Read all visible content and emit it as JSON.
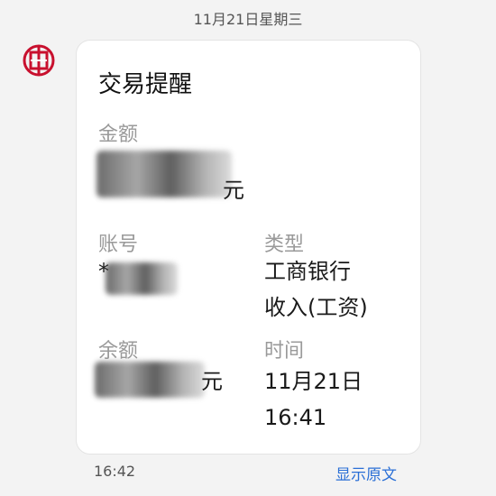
{
  "date_header": "11月21日星期三",
  "card": {
    "title": "交易提醒",
    "amount_label": "金额",
    "amount_unit": "元",
    "account_label": "账号",
    "account_masked": "*",
    "type_label": "类型",
    "type_bank": "工商银行",
    "type_detail": "收入(工资)",
    "balance_label": "余额",
    "balance_unit": "元",
    "time_label": "时间",
    "time_date": "11月21日",
    "time_clock": "16:41"
  },
  "footer": {
    "timestamp": "16:42",
    "view_original": "显示原文"
  },
  "colors": {
    "brand_red": "#c8102e",
    "link_blue": "#2a6fd6"
  }
}
